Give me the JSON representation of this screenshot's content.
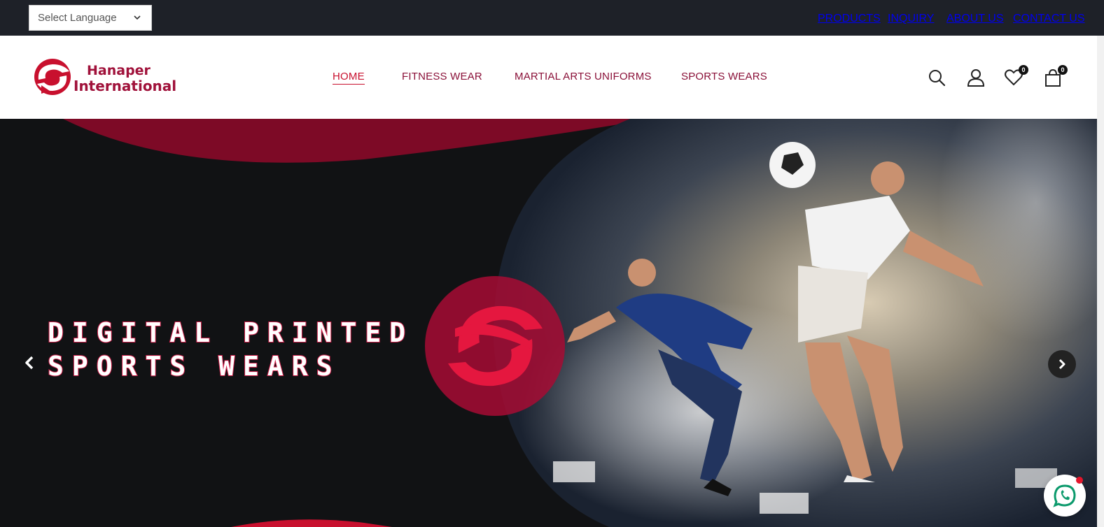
{
  "topbar": {
    "language_select": {
      "value": "Select Language",
      "icon": "chevron-down-icon"
    },
    "links": {
      "products": "PRODUCTS",
      "inquiry": "INQUIRY",
      "about": "ABOUT US",
      "contact": "CONTACT US"
    }
  },
  "header": {
    "logo": {
      "line1": "Hanaper",
      "line2": "International"
    },
    "nav": {
      "home": "HOME",
      "fitness": "FITNESS WEAR",
      "martial": "MARTIAL ARTS UNIFORMS",
      "sports": "SPORTS WEARS"
    },
    "icons": {
      "search": "search-icon",
      "account": "user-icon",
      "wishlist": "heart-icon",
      "cart": "shopping-bag-icon"
    },
    "wishlist_count": "0",
    "cart_count": "0"
  },
  "hero": {
    "title_line1": "DiGiTAL PRINTED",
    "title_line2": "SPORTS WEARS",
    "prev_icon": "chevron-left-icon",
    "next_icon": "chevron-right-icon"
  },
  "floating": {
    "whatsapp_icon": "whatsapp-icon"
  },
  "colors": {
    "brand": "#a0113a",
    "accent": "#c8102e",
    "topbar": "#1e2128",
    "hero_bg": "#111214"
  }
}
